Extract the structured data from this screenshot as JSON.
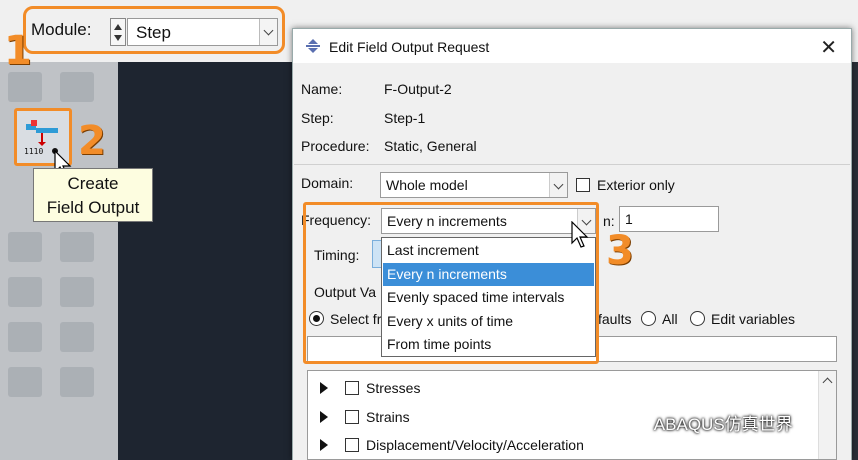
{
  "module": {
    "label": "Module:",
    "value": "Step"
  },
  "callouts": [
    "1",
    "2",
    "3"
  ],
  "tool": {
    "tooltip_line1": "Create",
    "tooltip_line2": "Field Output",
    "icon": "create-field-output-icon"
  },
  "dialog": {
    "title": "Edit Field Output Request",
    "close_icon": "close-icon",
    "name_label": "Name:",
    "name_value": "F-Output-2",
    "step_label": "Step:",
    "step_value": "Step-1",
    "procedure_label": "Procedure:",
    "procedure_value": "Static, General",
    "domain_label": "Domain:",
    "domain_value": "Whole model",
    "exterior_label": "Exterior only",
    "frequency_label": "Frequency:",
    "frequency_value": "Every n increments",
    "n_label_visible": "n:",
    "n_value": "1",
    "timing_label": "Timing:",
    "timing_value_partial": "C",
    "output_vars_label": "Output Va",
    "select_from_partial": "Select fr",
    "defaults_partial": "faults",
    "all_label": "All",
    "edit_vars_label": "Edit variables",
    "frequency_options": [
      "Last increment",
      "Every n increments",
      "Evenly spaced time intervals",
      "Every x units of time",
      "From time points"
    ],
    "frequency_selected_index": 1,
    "tree": [
      "Stresses",
      "Strains",
      "Displacement/Velocity/Acceleration"
    ]
  },
  "watermark": "ABAQUS仿真世界",
  "colors": {
    "callout": "#f28c28",
    "highlight": "#3b8ed8"
  }
}
